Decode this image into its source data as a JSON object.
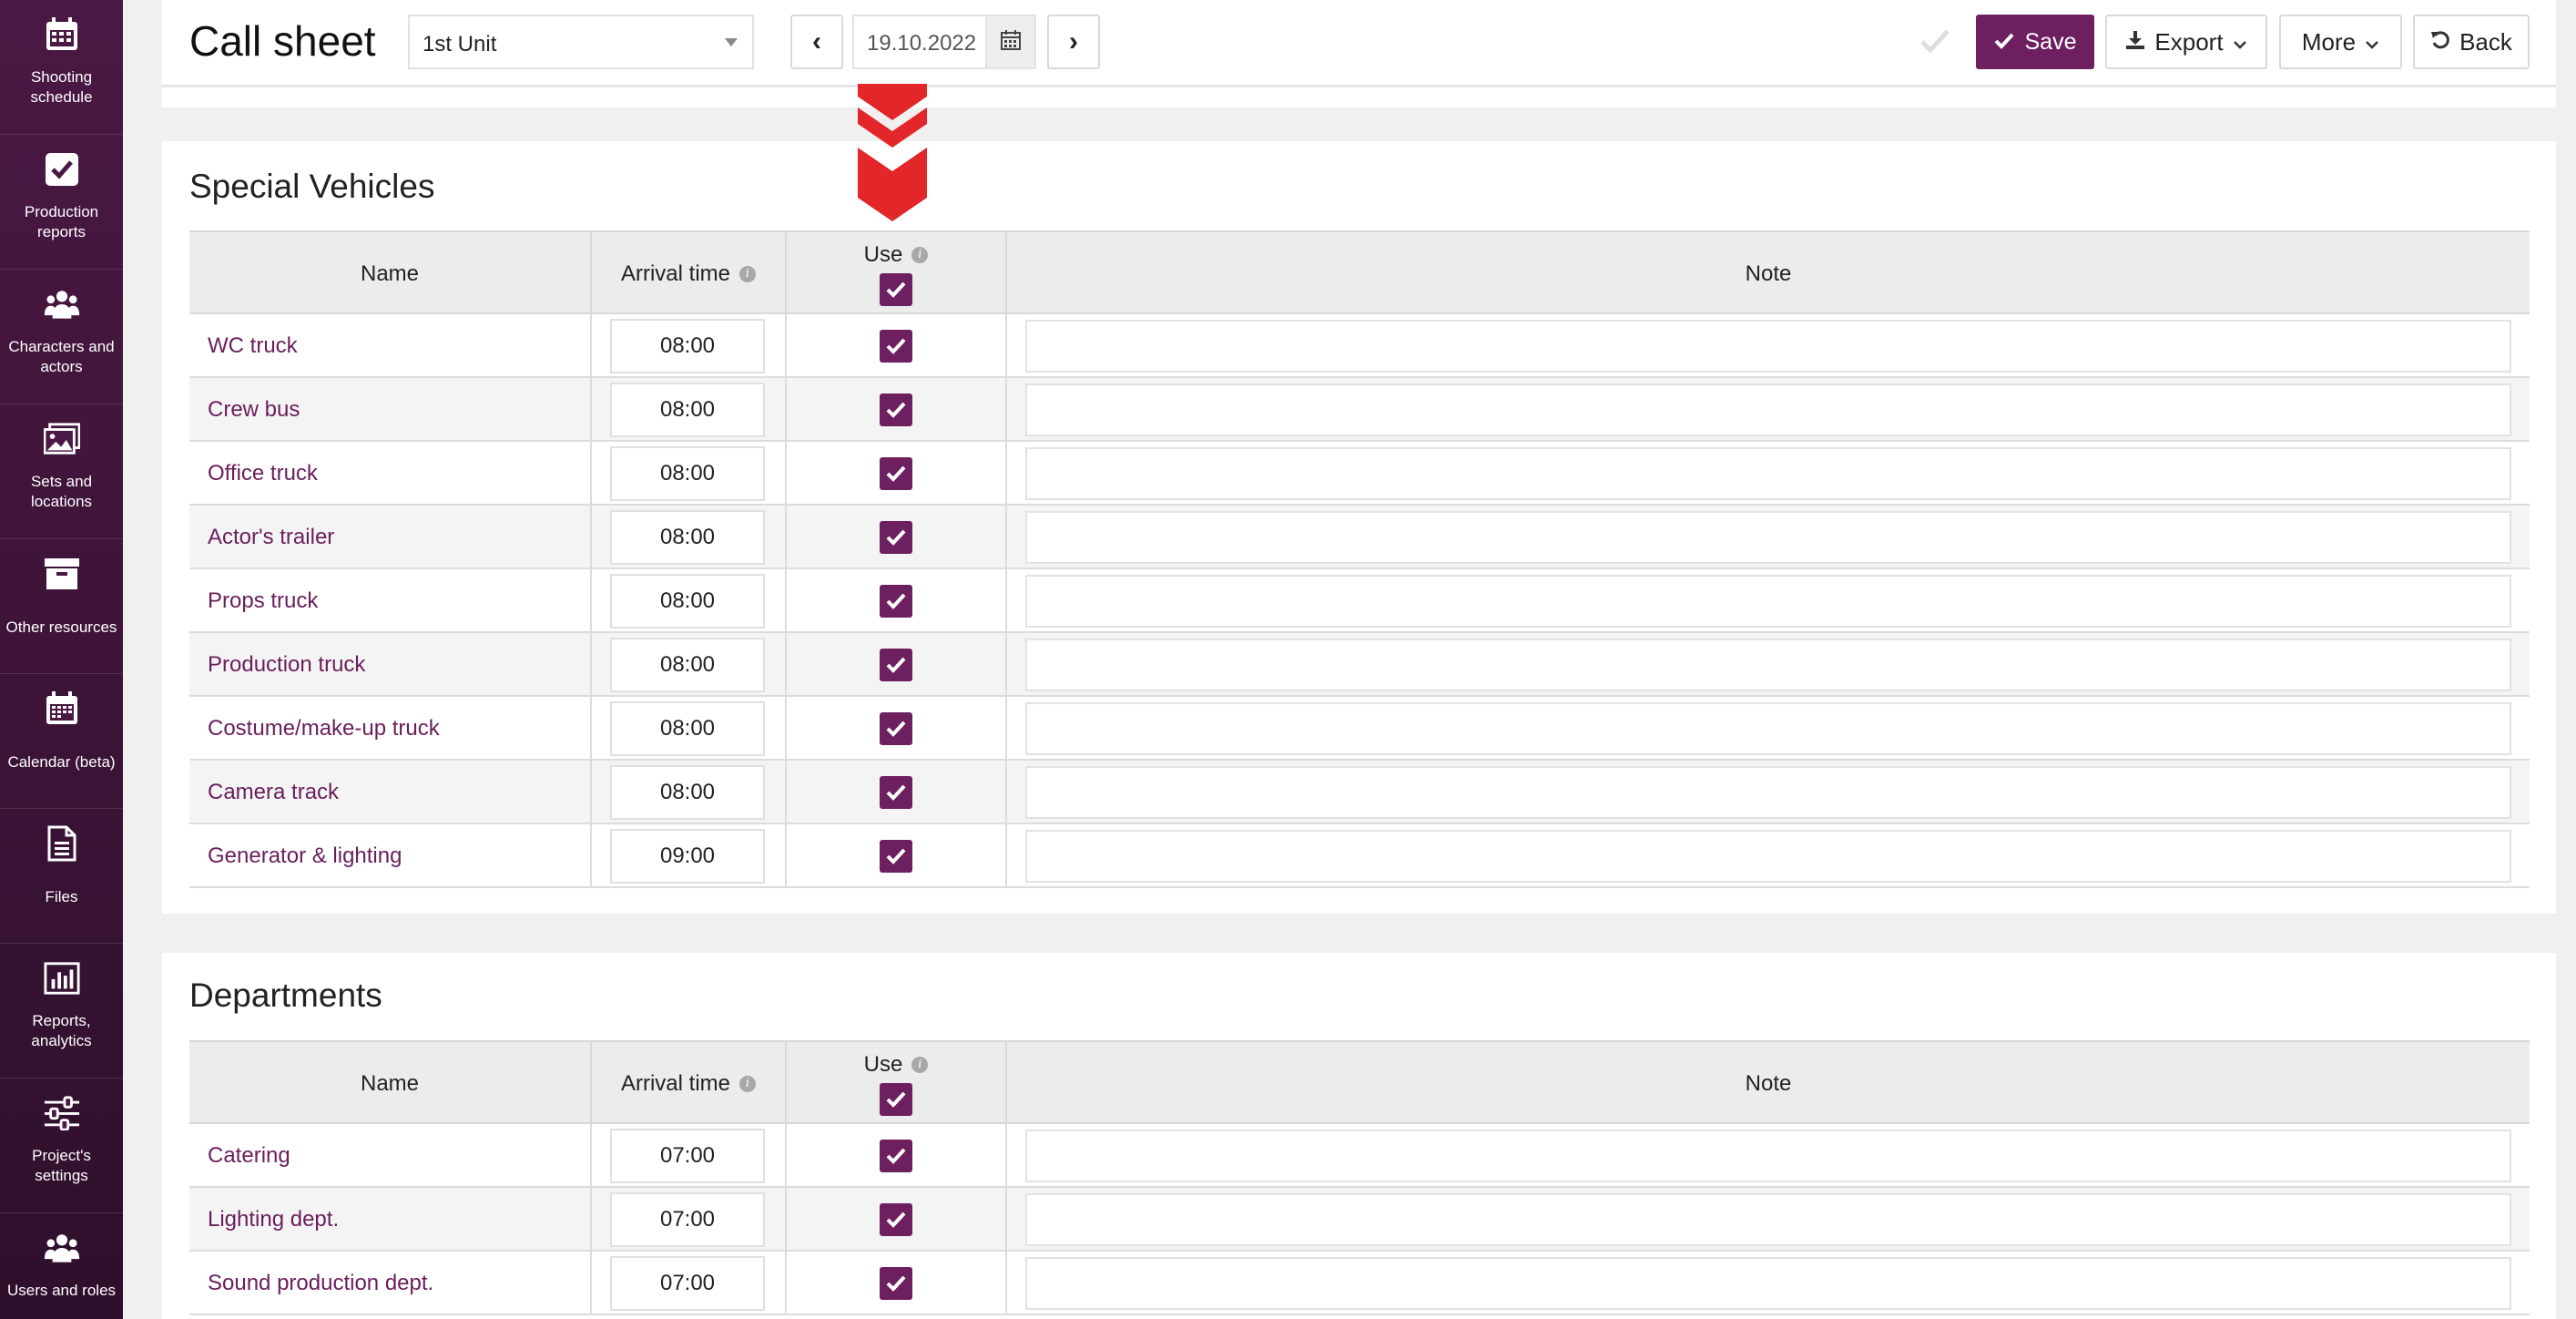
{
  "sidebar": {
    "items": [
      {
        "label": "Shooting schedule",
        "icon": "calendar-grid-icon"
      },
      {
        "label": "Production reports",
        "icon": "checkbox-icon"
      },
      {
        "label": "Characters and actors",
        "icon": "users-icon"
      },
      {
        "label": "Sets and locations",
        "icon": "image-icon"
      },
      {
        "label": "Other resources",
        "icon": "archive-icon"
      },
      {
        "label": "Calendar (beta)",
        "icon": "calendar-icon"
      },
      {
        "label": "Files",
        "icon": "file-icon"
      },
      {
        "label": "Reports, analytics",
        "icon": "bar-chart-icon"
      },
      {
        "label": "Project's settings",
        "icon": "sliders-icon"
      },
      {
        "label": "Users and roles",
        "icon": "users-icon"
      }
    ]
  },
  "header": {
    "title": "Call sheet",
    "unit_select": "1st Unit",
    "prev": "‹",
    "next": "›",
    "date": "19.10.2022",
    "save": "Save",
    "export": "Export",
    "more": "More",
    "back": "Back"
  },
  "colors": {
    "accent": "#6d1f60",
    "link": "#6a1e5c",
    "arrow": "#e3262a"
  },
  "special_vehicles": {
    "title": "Special Vehicles",
    "columns": {
      "name": "Name",
      "arrival": "Arrival time",
      "use": "Use",
      "note": "Note"
    },
    "rows": [
      {
        "name": "WC truck",
        "time": "08:00",
        "use": true,
        "note": ""
      },
      {
        "name": "Crew bus",
        "time": "08:00",
        "use": true,
        "note": ""
      },
      {
        "name": "Office truck",
        "time": "08:00",
        "use": true,
        "note": ""
      },
      {
        "name": "Actor's trailer",
        "time": "08:00",
        "use": true,
        "note": ""
      },
      {
        "name": "Props truck",
        "time": "08:00",
        "use": true,
        "note": ""
      },
      {
        "name": "Production truck",
        "time": "08:00",
        "use": true,
        "note": ""
      },
      {
        "name": "Costume/make-up truck",
        "time": "08:00",
        "use": true,
        "note": ""
      },
      {
        "name": "Camera track",
        "time": "08:00",
        "use": true,
        "note": ""
      },
      {
        "name": "Generator & lighting",
        "time": "09:00",
        "use": true,
        "note": ""
      }
    ]
  },
  "departments": {
    "title": "Departments",
    "columns": {
      "name": "Name",
      "arrival": "Arrival time",
      "use": "Use",
      "note": "Note"
    },
    "rows": [
      {
        "name": "Catering",
        "time": "07:00",
        "use": true,
        "note": ""
      },
      {
        "name": "Lighting dept.",
        "time": "07:00",
        "use": true,
        "note": ""
      },
      {
        "name": "Sound production dept.",
        "time": "07:00",
        "use": true,
        "note": ""
      }
    ]
  }
}
